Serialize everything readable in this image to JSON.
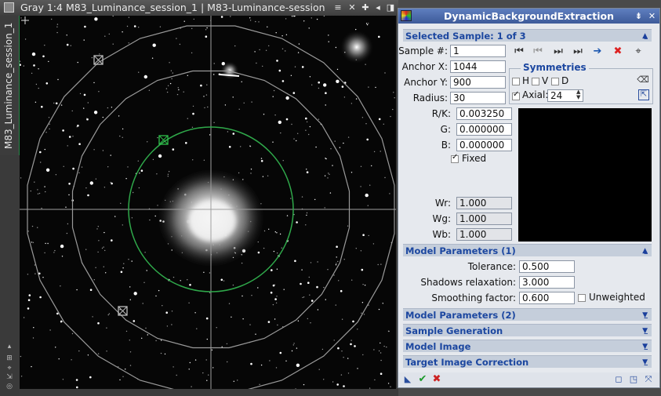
{
  "image_window": {
    "title": "Gray 1:4 M83_Luminance_session_1 | M83-Luminance-session ...",
    "view_tab_label": "M83_Luminance_session_1",
    "title_buttons": [
      "≡",
      "✕",
      "✚",
      "◂",
      "◨"
    ],
    "left_tools": [
      "◎",
      "⇲",
      "⌖",
      "⊞",
      "▴"
    ]
  },
  "dialog": {
    "title": "DynamicBackgroundExtraction",
    "title_buttons": [
      "⇟",
      "✕"
    ],
    "selected_sample": {
      "header": "Selected Sample: 1 of 3",
      "sample_label": "Sample #:",
      "sample_value": "1",
      "anchor_x_label": "Anchor X:",
      "anchor_x_value": "1044",
      "anchor_y_label": "Anchor Y:",
      "anchor_y_value": "900",
      "radius_label": "Radius:",
      "radius_value": "30",
      "rk_label": "R/K:",
      "rk_value": "0.003250",
      "g_label": "G:",
      "g_value": "0.000000",
      "b_label": "B:",
      "b_value": "0.000000",
      "fixed_label": "Fixed",
      "fixed_checked": true,
      "wr_label": "Wr:",
      "wr_value": "1.000",
      "wg_label": "Wg:",
      "wg_value": "1.000",
      "wb_label": "Wb:",
      "wb_value": "1.000",
      "nav_icons": [
        "first-icon",
        "previous-icon",
        "next-icon",
        "last-icon",
        "goto-icon",
        "delete-icon",
        "center-icon"
      ]
    },
    "symmetries": {
      "title": "Symmetries",
      "h_label": "H",
      "v_label": "V",
      "d_label": "D",
      "axial_label": "Axial:",
      "axial_value": "24",
      "axial_checked": true
    },
    "model_parameters_1": {
      "header": "Model Parameters (1)",
      "tolerance_label": "Tolerance:",
      "tolerance_value": "0.500",
      "shadows_label": "Shadows relaxation:",
      "shadows_value": "3.000",
      "smoothing_label": "Smoothing factor:",
      "smoothing_value": "0.600",
      "unweighted_label": "Unweighted"
    },
    "collapsed_sections": [
      "Model Parameters (2)",
      "Sample Generation",
      "Model Image",
      "Target Image Correction"
    ],
    "colors": {
      "section_text": "#1c47a0",
      "title_bar": "#4a67a8",
      "accept": "#1b9a2a",
      "cancel": "#cc2222"
    }
  }
}
